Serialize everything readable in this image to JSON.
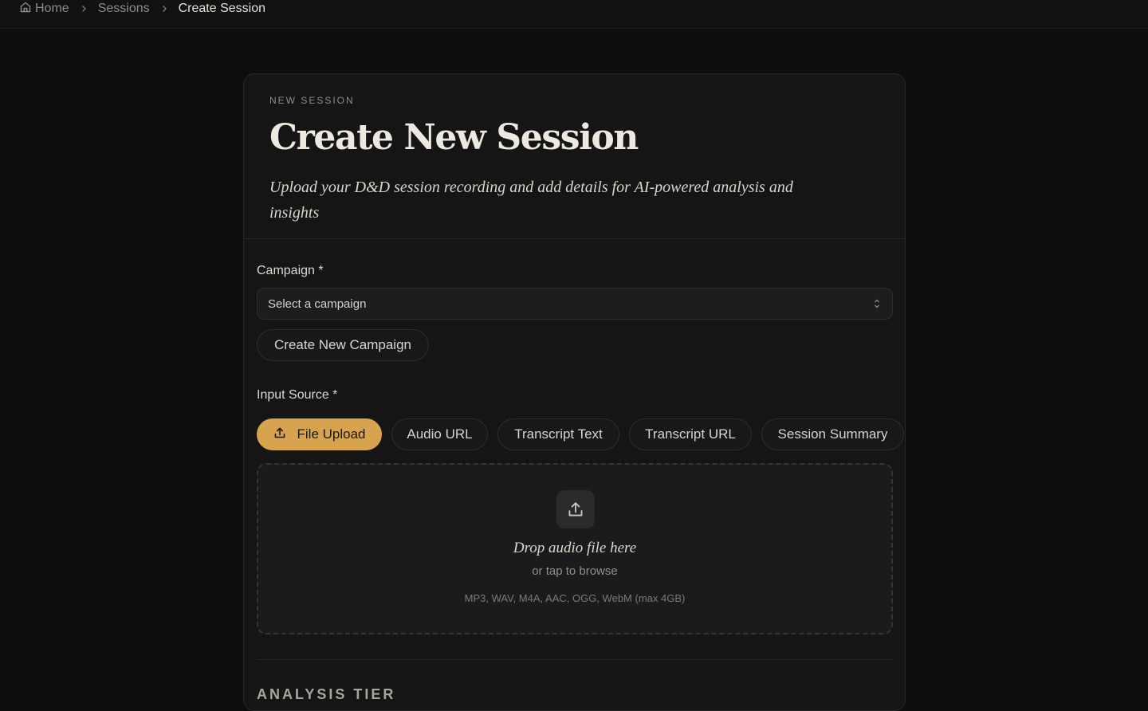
{
  "breadcrumb": {
    "items": [
      "Home",
      "Sessions",
      "Create Session"
    ]
  },
  "header": {
    "eyebrow": "NEW SESSION",
    "title": "Create New Session",
    "subtitle": "Upload your D&D session recording and add details for AI-powered analysis and insights"
  },
  "campaign": {
    "label": "Campaign *",
    "select_placeholder": "Select a campaign",
    "create_button": "Create New Campaign"
  },
  "input_source": {
    "label": "Input Source *",
    "tabs": [
      "File Upload",
      "Audio URL",
      "Transcript Text",
      "Transcript URL",
      "Session Summary"
    ],
    "active_tab": "File Upload"
  },
  "dropzone": {
    "title": "Drop audio file here",
    "subtitle": "or tap to browse",
    "formats": "MP3, WAV, M4A, AAC, OGG, WebM (max 4GB)"
  },
  "analysis": {
    "section_title": "ANALYSIS TIER"
  },
  "colors": {
    "accent": "#d8a34f",
    "background": "#0d0d0d",
    "card": "#151515"
  },
  "icons": {
    "home": "home-icon",
    "separator": "chevron-right-icon",
    "select": "chevron-up-down-icon",
    "upload": "upload-icon"
  }
}
